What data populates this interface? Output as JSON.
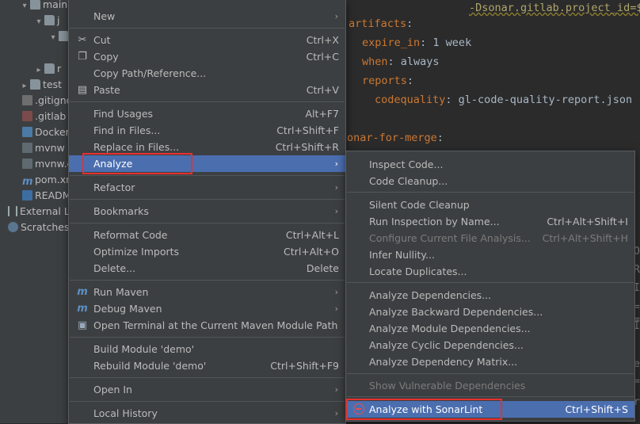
{
  "tree": {
    "items": [
      "main",
      "j",
      "",
      "r",
      "test",
      ".gitignore",
      ".gitlab",
      "Docker",
      "mvnw",
      "mvnw.c",
      "pom.xr",
      "READM",
      "External Li",
      "Scratches"
    ]
  },
  "editor": {
    "lines": {
      "l1": "-Dsonar.gitlab.project_id=$",
      "l2_key": "artifacts",
      "l3_key": "expire_in",
      "l3_val": " 1 week",
      "l4_key": "when",
      "l4_val": " always",
      "l5_key": "reports",
      "l6_key": "codequality",
      "l6_val": " gl-code-quality-report.json",
      "l7": "onar-for-merge"
    },
    "edge_fragments": [
      "O",
      "R",
      "I",
      "=",
      "=",
      "I",
      "e",
      "=",
      "r"
    ]
  },
  "main_menu": {
    "items": {
      "new": "New",
      "cut": "Cut",
      "cut_sc": "Ctrl+X",
      "copy": "Copy",
      "copy_sc": "Ctrl+C",
      "copy_path": "Copy Path/Reference...",
      "paste": "Paste",
      "paste_sc": "Ctrl+V",
      "find_usages": "Find Usages",
      "find_usages_sc": "Alt+F7",
      "find_in_files": "Find in Files...",
      "find_in_files_sc": "Ctrl+Shift+F",
      "replace_in_files": "Replace in Files...",
      "replace_in_files_sc": "Ctrl+Shift+R",
      "analyze": "Analyze",
      "refactor": "Refactor",
      "bookmarks": "Bookmarks",
      "reformat": "Reformat Code",
      "reformat_sc": "Ctrl+Alt+L",
      "optimize": "Optimize Imports",
      "optimize_sc": "Ctrl+Alt+O",
      "delete": "Delete...",
      "delete_sc": "Delete",
      "run_maven": "Run Maven",
      "debug_maven": "Debug Maven",
      "open_terminal": "Open Terminal at the Current Maven Module Path",
      "build_module": "Build Module 'demo'",
      "rebuild_module": "Rebuild Module 'demo'",
      "rebuild_module_sc": "Ctrl+Shift+F9",
      "open_in": "Open In",
      "local_history": "Local History"
    }
  },
  "sub_menu": {
    "items": {
      "inspect": "Inspect Code...",
      "cleanup": "Code Cleanup...",
      "silent_cleanup": "Silent Code Cleanup",
      "run_inspection": "Run Inspection by Name...",
      "run_inspection_sc": "Ctrl+Alt+Shift+I",
      "configure": "Configure Current File Analysis...",
      "configure_sc": "Ctrl+Alt+Shift+H",
      "infer_nullity": "Infer Nullity...",
      "locate_dup": "Locate Duplicates...",
      "deps": "Analyze Dependencies...",
      "back_deps": "Analyze Backward Dependencies...",
      "module_deps": "Analyze Module Dependencies...",
      "cyclic_deps": "Analyze Cyclic Dependencies...",
      "dep_matrix": "Analyze Dependency Matrix...",
      "vuln": "Show Vulnerable Dependencies",
      "sonarlint": "Analyze with SonarLint",
      "sonarlint_sc": "Ctrl+Shift+S"
    }
  },
  "colors": {
    "menu_bg": "#3c3f41",
    "selection": "#4b6eaf",
    "highlight_box": "#e8302f",
    "editor_bg": "#2b2b2b",
    "keyword": "#cc7832"
  }
}
